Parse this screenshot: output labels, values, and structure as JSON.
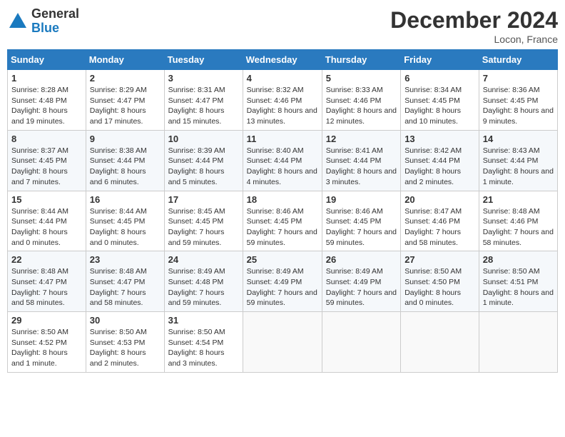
{
  "header": {
    "logo_general": "General",
    "logo_blue": "Blue",
    "month_title": "December 2024",
    "location": "Locon, France"
  },
  "weekdays": [
    "Sunday",
    "Monday",
    "Tuesday",
    "Wednesday",
    "Thursday",
    "Friday",
    "Saturday"
  ],
  "weeks": [
    [
      {
        "day": 1,
        "sunrise": "8:28 AM",
        "sunset": "4:48 PM",
        "daylight": "8 hours and 19 minutes."
      },
      {
        "day": 2,
        "sunrise": "8:29 AM",
        "sunset": "4:47 PM",
        "daylight": "8 hours and 17 minutes."
      },
      {
        "day": 3,
        "sunrise": "8:31 AM",
        "sunset": "4:47 PM",
        "daylight": "8 hours and 15 minutes."
      },
      {
        "day": 4,
        "sunrise": "8:32 AM",
        "sunset": "4:46 PM",
        "daylight": "8 hours and 13 minutes."
      },
      {
        "day": 5,
        "sunrise": "8:33 AM",
        "sunset": "4:46 PM",
        "daylight": "8 hours and 12 minutes."
      },
      {
        "day": 6,
        "sunrise": "8:34 AM",
        "sunset": "4:45 PM",
        "daylight": "8 hours and 10 minutes."
      },
      {
        "day": 7,
        "sunrise": "8:36 AM",
        "sunset": "4:45 PM",
        "daylight": "8 hours and 9 minutes."
      }
    ],
    [
      {
        "day": 8,
        "sunrise": "8:37 AM",
        "sunset": "4:45 PM",
        "daylight": "8 hours and 7 minutes."
      },
      {
        "day": 9,
        "sunrise": "8:38 AM",
        "sunset": "4:44 PM",
        "daylight": "8 hours and 6 minutes."
      },
      {
        "day": 10,
        "sunrise": "8:39 AM",
        "sunset": "4:44 PM",
        "daylight": "8 hours and 5 minutes."
      },
      {
        "day": 11,
        "sunrise": "8:40 AM",
        "sunset": "4:44 PM",
        "daylight": "8 hours and 4 minutes."
      },
      {
        "day": 12,
        "sunrise": "8:41 AM",
        "sunset": "4:44 PM",
        "daylight": "8 hours and 3 minutes."
      },
      {
        "day": 13,
        "sunrise": "8:42 AM",
        "sunset": "4:44 PM",
        "daylight": "8 hours and 2 minutes."
      },
      {
        "day": 14,
        "sunrise": "8:43 AM",
        "sunset": "4:44 PM",
        "daylight": "8 hours and 1 minute."
      }
    ],
    [
      {
        "day": 15,
        "sunrise": "8:44 AM",
        "sunset": "4:44 PM",
        "daylight": "8 hours and 0 minutes."
      },
      {
        "day": 16,
        "sunrise": "8:44 AM",
        "sunset": "4:45 PM",
        "daylight": "8 hours and 0 minutes."
      },
      {
        "day": 17,
        "sunrise": "8:45 AM",
        "sunset": "4:45 PM",
        "daylight": "7 hours and 59 minutes."
      },
      {
        "day": 18,
        "sunrise": "8:46 AM",
        "sunset": "4:45 PM",
        "daylight": "7 hours and 59 minutes."
      },
      {
        "day": 19,
        "sunrise": "8:46 AM",
        "sunset": "4:45 PM",
        "daylight": "7 hours and 59 minutes."
      },
      {
        "day": 20,
        "sunrise": "8:47 AM",
        "sunset": "4:46 PM",
        "daylight": "7 hours and 58 minutes."
      },
      {
        "day": 21,
        "sunrise": "8:48 AM",
        "sunset": "4:46 PM",
        "daylight": "7 hours and 58 minutes."
      }
    ],
    [
      {
        "day": 22,
        "sunrise": "8:48 AM",
        "sunset": "4:47 PM",
        "daylight": "7 hours and 58 minutes."
      },
      {
        "day": 23,
        "sunrise": "8:48 AM",
        "sunset": "4:47 PM",
        "daylight": "7 hours and 58 minutes."
      },
      {
        "day": 24,
        "sunrise": "8:49 AM",
        "sunset": "4:48 PM",
        "daylight": "7 hours and 59 minutes."
      },
      {
        "day": 25,
        "sunrise": "8:49 AM",
        "sunset": "4:49 PM",
        "daylight": "7 hours and 59 minutes."
      },
      {
        "day": 26,
        "sunrise": "8:49 AM",
        "sunset": "4:49 PM",
        "daylight": "7 hours and 59 minutes."
      },
      {
        "day": 27,
        "sunrise": "8:50 AM",
        "sunset": "4:50 PM",
        "daylight": "8 hours and 0 minutes."
      },
      {
        "day": 28,
        "sunrise": "8:50 AM",
        "sunset": "4:51 PM",
        "daylight": "8 hours and 1 minute."
      }
    ],
    [
      {
        "day": 29,
        "sunrise": "8:50 AM",
        "sunset": "4:52 PM",
        "daylight": "8 hours and 1 minute."
      },
      {
        "day": 30,
        "sunrise": "8:50 AM",
        "sunset": "4:53 PM",
        "daylight": "8 hours and 2 minutes."
      },
      {
        "day": 31,
        "sunrise": "8:50 AM",
        "sunset": "4:54 PM",
        "daylight": "8 hours and 3 minutes."
      },
      null,
      null,
      null,
      null
    ]
  ]
}
